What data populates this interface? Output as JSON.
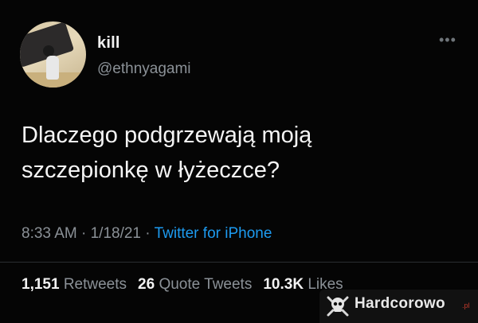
{
  "tweet": {
    "display_name": "kill",
    "handle": "@ethnyagami",
    "more_icon": "more-dots-icon",
    "text_line1": "Dlaczego podgrzewają moją",
    "text_line2": "szczepionkę w łyżeczce?",
    "time": "8:33 AM",
    "separator1": " · ",
    "date": "1/18/21",
    "separator2": " · ",
    "source": "Twitter for iPhone",
    "retweets_count": "1,151",
    "retweets_label": "Retweets",
    "quote_count": "26",
    "quote_label": "Quote Tweets",
    "likes_count": "10.3K",
    "likes_label": "Likes"
  },
  "watermark": {
    "brand": "Hardcorowo",
    "domain": ".pl",
    "icon": "skull-icon"
  },
  "colors": {
    "background": "#050505",
    "primary_text": "#f5f5f5",
    "secondary_text": "#8b9197",
    "link": "#1d9bf0"
  }
}
